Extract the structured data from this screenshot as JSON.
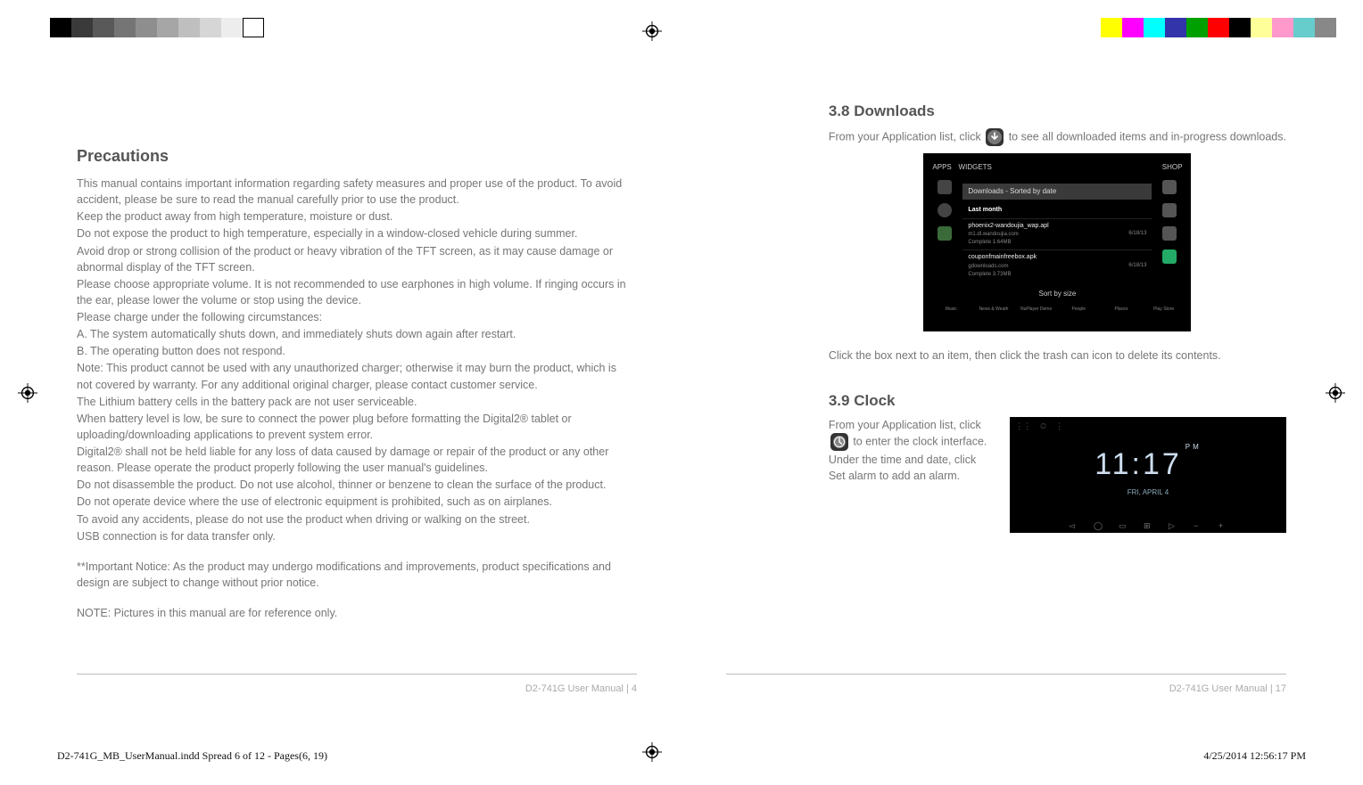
{
  "left_page": {
    "heading": "Precautions",
    "paragraphs": [
      "This manual contains important information regarding safety measures and proper use of the product. To avoid accident, please be sure to read the manual carefully prior to use the product.",
      "Keep the product away from high temperature, moisture or dust.",
      "Do not expose the product to high temperature, especially in a window-closed vehicle during summer.",
      "Avoid drop or strong collision of the product or heavy vibration of the TFT screen, as it may cause damage or abnormal display of the TFT screen.",
      "Please choose appropriate volume. It is not recommended to use earphones in high volume. If ringing occurs in the ear, please lower the volume or stop using the device.",
      "Please charge under the following circumstances:",
      "A. The system automatically shuts down, and immediately shuts down again after restart.",
      "B. The operating button does not respond.",
      "Note: This product cannot be used with any unauthorized charger; otherwise it may burn the product, which is not covered by warranty. For any additional original charger, please contact customer service.",
      "The Lithium battery cells in the battery pack are not user serviceable.",
      "When battery level is low, be sure to connect the power plug before formatting the Digital2® tablet or uploading/downloading applications to prevent system error.",
      "Digital2® shall not be held liable for any loss of data caused by damage or repair of the product or any other reason. Please operate the product properly following the user manual's guidelines.",
      "Do not disassemble the product. Do not use alcohol, thinner or benzene to clean the surface of the product.",
      "Do not operate device where the use of electronic equipment is prohibited, such as on airplanes.",
      "To avoid any accidents, please do not use the product when driving or walking on the street.",
      "USB connection is for data transfer only."
    ],
    "notice": "**Important Notice: As the product may undergo modifications and improvements, product specifications and design are subject to change without prior notice.",
    "note": "NOTE: Pictures in this manual are for reference only.",
    "footer": "D2-741G User Manual | 4"
  },
  "right_page": {
    "sections": {
      "downloads": {
        "heading": "3.8 Downloads",
        "line1_a": "From your Application list, click ",
        "line1_b": " to see all downloaded items and in-progress downloads.",
        "instruction": "Click the box next to an item, then click the trash can icon to delete its contents.",
        "screenshot": {
          "tabs": [
            "APPS",
            "WIDGETS"
          ],
          "shop": "SHOP",
          "title": "Downloads - Sorted by date",
          "group": "Last month",
          "items": [
            {
              "name": "phoenix2-wandoujia_wap.apl",
              "sub": "m1.dl.wandoujia.com",
              "status": "Complete   1.64MB",
              "date": "6/18/13"
            },
            {
              "name": "couponfmainfreebox.apk",
              "sub": "gdownloads.com",
              "status": "Complete   3.73MB",
              "date": "6/18/13"
            }
          ],
          "sort": "Sort by size",
          "bottom_labels": [
            "Music",
            "News & Weath",
            "NuPlayer Demo",
            "People",
            "Places",
            "Play Store"
          ]
        }
      },
      "clock": {
        "heading": "3.9 Clock",
        "line1_a": "From your Application list, click ",
        "line1_b": " to enter the clock interface.",
        "line2": "Under the time and date, click Set alarm to add an alarm.",
        "screenshot": {
          "time": "11:17",
          "ampm": "PM",
          "date": "FRI, APRIL 4"
        }
      }
    },
    "footer": "D2-741G User Manual | 17"
  },
  "doc_footer": {
    "left": "D2-741G_MB_UserManual.indd   Spread 6 of 12 - Pages(6, 19)",
    "right": "4/25/2014   12:56:17 PM"
  },
  "colors": {
    "left_strip": [
      "#000000",
      "#3a3a3a",
      "#595959",
      "#757575",
      "#8e8e8e",
      "#a6a6a6",
      "#bfbfbf",
      "#d6d6d6",
      "#ededed",
      "#ffffff"
    ],
    "right_strip": [
      "#ffff00",
      "#ff00ff",
      "#00ffff",
      "#3333aa",
      "#00a000",
      "#ff0000",
      "#000000",
      "#ffff99",
      "#ff99cc",
      "#66cccc",
      "#888888"
    ]
  }
}
